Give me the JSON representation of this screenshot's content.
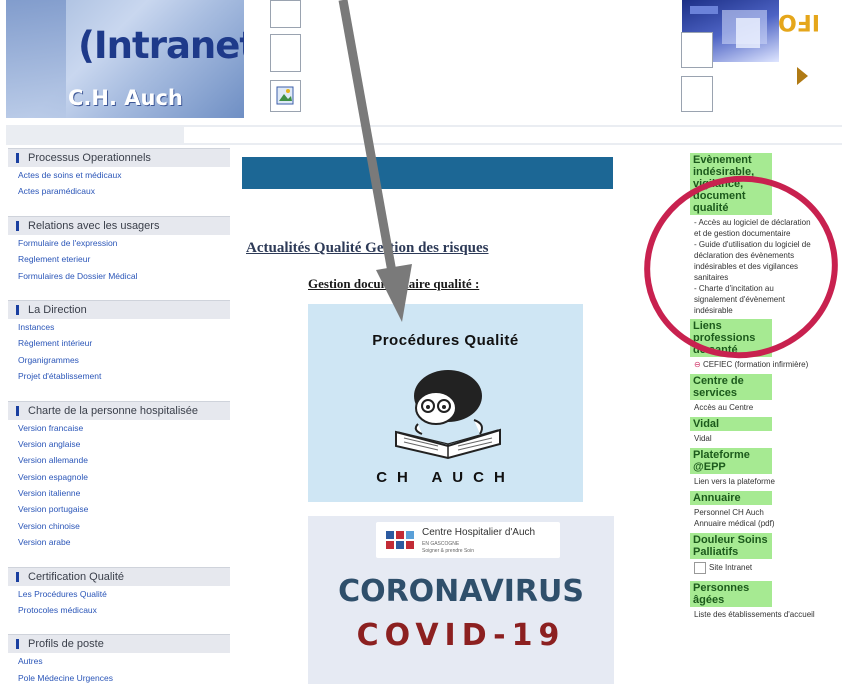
{
  "header": {
    "logo_title": "(Intranet)",
    "logo_subtitle": "C.H. Auch",
    "info_text": "IFO"
  },
  "left_nav": [
    {
      "title": "Processus Operationnels",
      "links": [
        "Actes de soins et médicaux",
        "Actes paramédicaux"
      ]
    },
    {
      "title": "Relations avec les usagers",
      "links": [
        "Formulaire de l'expression",
        "Reglement eterieur",
        "Formulaires de Dossier Médical"
      ]
    },
    {
      "title": "La Direction",
      "links": [
        "Instances",
        "Règlement intérieur",
        "Organigrammes",
        "Projet d'établissement"
      ]
    },
    {
      "title": "Charte de la personne hospitalisée",
      "links": [
        "Version francaise",
        "Version anglaise",
        "Version allemande",
        "Version espagnole",
        "Version italienne",
        "Version portugaise",
        "Version chinoise",
        "Version arabe"
      ]
    },
    {
      "title": "Certification Qualité",
      "links": [
        "Les Procédures Qualité",
        "Protocoles médicaux"
      ]
    },
    {
      "title": "Profils de poste",
      "links": [
        "Autres",
        "Pole Médecine Urgences"
      ]
    }
  ],
  "main": {
    "news_title": "Actualités Qualité Gestion des risques",
    "gestion_title": "Gestion documentaire qualité :",
    "procedures_title": "Procédures Qualité",
    "procedures_subtitle": "CH AUCH",
    "hospital_name": "Centre Hospitalier d'Auch",
    "hospital_region": "EN GASCOGNE",
    "hospital_motto": "Soigner & prendre Soin",
    "coronavirus": "CORONAVIRUS",
    "covid": "COVID-19"
  },
  "right_nav": [
    {
      "title": "Evènement indésirable, vigilance, document qualité",
      "links": [
        "- Accès au logiciel de déclaration",
        "et de gestion documentaire",
        "- Guide d'utilisation du logiciel de",
        "déclaration des évènements",
        "indésirables et des vigilances",
        "sanitaires",
        "- Charte d'incitation au",
        "signalement d'évènement",
        "indésirable"
      ]
    },
    {
      "title": "Liens professions de santé",
      "links": [
        "CEFIEC (formation infirmière)"
      ]
    },
    {
      "title": "Centre de services",
      "links": [
        "Accès au Centre"
      ]
    },
    {
      "title": "Vidal",
      "links": [
        "Vidal"
      ]
    },
    {
      "title": "Plateforme @EPP",
      "links": [
        "Lien vers la plateforme"
      ]
    },
    {
      "title": "Annuaire",
      "links": [
        "Personnel CH Auch",
        "Annuaire médical (pdf)"
      ]
    },
    {
      "title": "Douleur Soins Palliatifs",
      "links": [
        "Site Intranet"
      ]
    },
    {
      "title": "Personnes âgées",
      "links": [
        "Liste des établissements d'accueil"
      ]
    }
  ],
  "colors": {
    "blue_bar": "#1c6795",
    "green_header": "#a6ea92",
    "annotation": "#c8214f",
    "arrow": "#7a7a7a"
  }
}
